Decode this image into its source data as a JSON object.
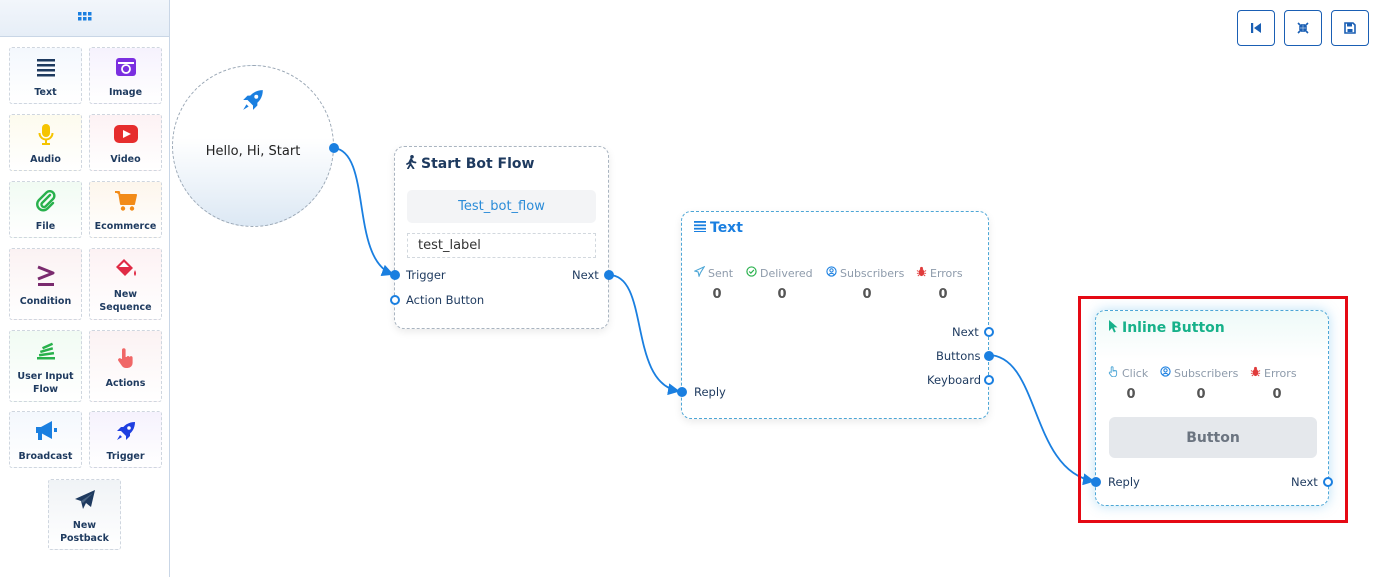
{
  "sidebar": {
    "items": [
      {
        "label": "Text",
        "icon": "text-lines-icon"
      },
      {
        "label": "Image",
        "icon": "image-icon"
      },
      {
        "label": "Audio",
        "icon": "microphone-icon"
      },
      {
        "label": "Video",
        "icon": "youtube-icon"
      },
      {
        "label": "File",
        "icon": "paperclip-icon"
      },
      {
        "label": "Ecommerce",
        "icon": "cart-icon"
      },
      {
        "label": "Condition",
        "icon": "condition-icon"
      },
      {
        "label": "New Sequence",
        "icon": "paint-bucket-icon"
      },
      {
        "label": "User Input Flow",
        "icon": "stack-icon"
      },
      {
        "label": "Actions",
        "icon": "hand-pointer-icon"
      },
      {
        "label": "Broadcast",
        "icon": "megaphone-icon"
      },
      {
        "label": "Trigger",
        "icon": "rocket-icon"
      },
      {
        "label": "New Postback",
        "icon": "paper-plane-icon"
      }
    ]
  },
  "start": {
    "keywords": "Hello, Hi, Start"
  },
  "start_bot_flow": {
    "title": "Start Bot Flow",
    "flow_name": "Test_bot_flow",
    "label": "test_label",
    "ports": {
      "trigger": "Trigger",
      "action_button": "Action Button",
      "next": "Next"
    }
  },
  "text_node": {
    "title": "Text",
    "stats": [
      {
        "label": "Sent",
        "value": "0"
      },
      {
        "label": "Delivered",
        "value": "0"
      },
      {
        "label": "Subscribers",
        "value": "0"
      },
      {
        "label": "Errors",
        "value": "0"
      }
    ],
    "ports": {
      "next": "Next",
      "buttons": "Buttons",
      "keyboard": "Keyboard",
      "reply": "Reply"
    }
  },
  "inline_button": {
    "title": "Inline Button",
    "stats": [
      {
        "label": "Click",
        "value": "0"
      },
      {
        "label": "Subscribers",
        "value": "0"
      },
      {
        "label": "Errors",
        "value": "0"
      }
    ],
    "button_label": "Button",
    "ports": {
      "reply": "Reply",
      "next": "Next"
    }
  },
  "colors": {
    "accent": "#1a7fe0",
    "highlight": "#e50914",
    "inline_title": "#17b18a",
    "title_dark": "#1e3a5f"
  }
}
